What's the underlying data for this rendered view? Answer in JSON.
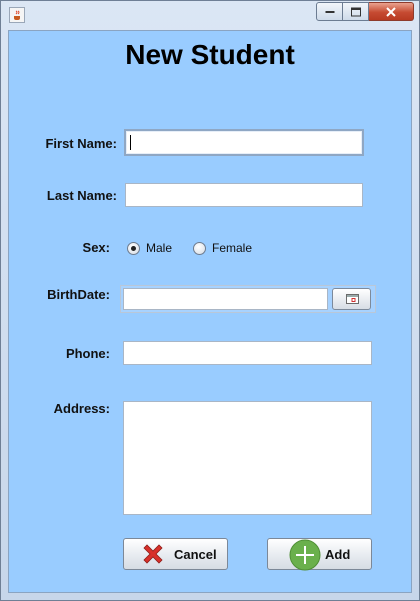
{
  "window": {
    "icon": "java-cup-icon",
    "controls": [
      "minimize-icon",
      "maximize-icon",
      "close-icon"
    ]
  },
  "form": {
    "title": "New Student",
    "first_name": {
      "label": "First Name:",
      "value": ""
    },
    "last_name": {
      "label": "Last Name:",
      "value": ""
    },
    "sex": {
      "label": "Sex:",
      "options": [
        "Male",
        "Female"
      ],
      "selected": "Male"
    },
    "birth_date": {
      "label": "BirthDate:",
      "value": "",
      "button_icon": "calendar-icon"
    },
    "phone": {
      "label": "Phone:",
      "value": ""
    },
    "address": {
      "label": "Address:",
      "value": ""
    }
  },
  "buttons": {
    "cancel": {
      "label": "Cancel",
      "icon": "x-icon",
      "icon_color": "#d8302a"
    },
    "add": {
      "label": "Add",
      "icon": "plus-icon",
      "icon_color": "#6ab04c"
    }
  },
  "colors": {
    "panel_background": "#99ccff"
  }
}
